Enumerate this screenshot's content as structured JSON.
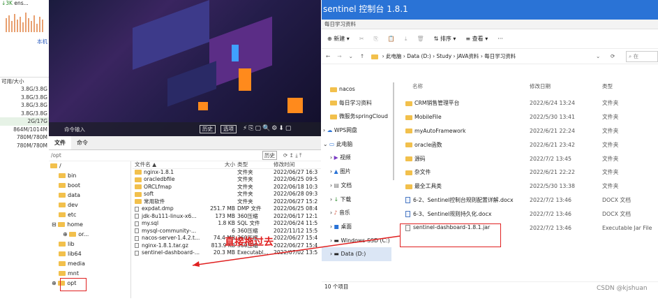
{
  "left_panel": {
    "speed": "↓3K",
    "host": "ens...",
    "native_label": "本机",
    "col_header": "可用/大小",
    "sizes": [
      "3.8G/3.8G",
      "3.8G/3.8G",
      "3.8G/3.8G",
      "3.8G/3.8G",
      "2G/17G",
      "864M/1014M",
      "780M/780M",
      "780M/780M"
    ]
  },
  "terminal": {
    "cmd_placeholder": "命令输入",
    "history_btn": "历史",
    "select_btn": "选项"
  },
  "file_manager": {
    "tabs": [
      "文件",
      "命令"
    ],
    "path": "/opt",
    "history_btn": "历史",
    "tree": [
      "/",
      "bin",
      "boot",
      "data",
      "dev",
      "etc",
      "home",
      "or...",
      "lib",
      "lib64",
      "media",
      "mnt",
      "opt"
    ],
    "columns": [
      "文件名 ▲",
      "大小",
      "类型",
      "修改时间"
    ],
    "files": [
      {
        "name": "nginx-1.8.1",
        "size": "",
        "type": "文件夹",
        "date": "2022/06/27 16:3"
      },
      {
        "name": "oracledbfile",
        "size": "",
        "type": "文件夹",
        "date": "2022/06/25 09:5"
      },
      {
        "name": "ORCLfmap",
        "size": "",
        "type": "文件夹",
        "date": "2022/06/18 10:3"
      },
      {
        "name": "soft",
        "size": "",
        "type": "文件夹",
        "date": "2022/06/28 09:3"
      },
      {
        "name": "常用软件",
        "size": "",
        "type": "文件夹",
        "date": "2022/06/27 15:2"
      },
      {
        "name": "expdat.dmp",
        "size": "251.7 MB",
        "type": "DMP 文件",
        "date": "2022/06/25 08:4"
      },
      {
        "name": "jdk-8u111-linux-x6...",
        "size": "173 MB",
        "type": "360压缩",
        "date": "2022/06/17 12:1"
      },
      {
        "name": "my.sql",
        "size": "1.8 KB",
        "type": "SQL 文件",
        "date": "2022/06/24 11:5"
      },
      {
        "name": "mysql-community-...",
        "size": "6",
        "type": "360压缩",
        "date": "2022/11/12 15:5"
      },
      {
        "name": "nacos-server-1.4.2.t...",
        "size": "74.4 MB",
        "type": "360压缩",
        "date": "2022/06/27 15:4"
      },
      {
        "name": "nginx-1.8.1.tar.gz",
        "size": "813.9 KB",
        "type": "360压缩",
        "date": "2022/06/27 15:4"
      },
      {
        "name": "sentinel-dashboard-...",
        "size": "20.3 MB",
        "type": "Executabl...",
        "date": "2022/07/02 13:5"
      }
    ]
  },
  "annotation": {
    "text": "直接拖过去"
  },
  "explorer": {
    "title": "sentinel 控制台 1.8.1",
    "tab": "每日学习资料",
    "cmds": [
      "⊕ 新建 ▾",
      "✂",
      "⎘",
      "📋",
      "⤓",
      "🗑",
      "⇅ 排序 ▾",
      "≡ 查看 ▾",
      "···"
    ],
    "breadcrumb": [
      "此电脑",
      "Data (D:)",
      "Study",
      "JAVA资料",
      "每日学习资料"
    ],
    "search_placeholder": "在",
    "nav": [
      "nacos",
      "每日学习资料",
      "微服务springCloud",
      "WPS网盘",
      "此电脑",
      "视频",
      "图片",
      "文档",
      "下载",
      "音乐",
      "桌面",
      "Windows-SSD (C:)",
      "Data (D:)"
    ],
    "columns": [
      "名称",
      "修改日期",
      "类型"
    ],
    "rows": [
      {
        "name": "CRM销售管理平台",
        "date": "2022/6/24 13:24",
        "type": "文件夹",
        "icon": "folder"
      },
      {
        "name": "MobileFile",
        "date": "2022/5/30 13:41",
        "type": "文件夹",
        "icon": "folder"
      },
      {
        "name": "myAutoFramework",
        "date": "2022/6/21 22:24",
        "type": "文件夹",
        "icon": "folder"
      },
      {
        "name": "oracle函数",
        "date": "2022/6/21 23:42",
        "type": "文件夹",
        "icon": "folder"
      },
      {
        "name": "源码",
        "date": "2022/7/2 13:45",
        "type": "文件夹",
        "icon": "folder"
      },
      {
        "name": "杂文件",
        "date": "2022/6/21 22:22",
        "type": "文件夹",
        "icon": "folder"
      },
      {
        "name": "最全工具类",
        "date": "2022/5/30 13:38",
        "type": "文件夹",
        "icon": "folder"
      },
      {
        "name": "6-2、Sentinel控制台规则配置详解.docx",
        "date": "2022/7/2 13:46",
        "type": "DOCX 文档",
        "icon": "doc"
      },
      {
        "name": "6-3、Sentinel规则持久化.docx",
        "date": "2022/7/2 13:46",
        "type": "DOCX 文档",
        "icon": "doc"
      },
      {
        "name": "sentinel-dashboard-1.8.1.jar",
        "date": "2022/7/2 13:46",
        "type": "Executable Jar File",
        "icon": "jar"
      }
    ],
    "status": "10 个项目"
  },
  "watermark": "CSDN @kjshuan",
  "colors": {
    "accent": "#2a73d6",
    "annotation": "#e02020",
    "folder": "#f2c04c"
  }
}
